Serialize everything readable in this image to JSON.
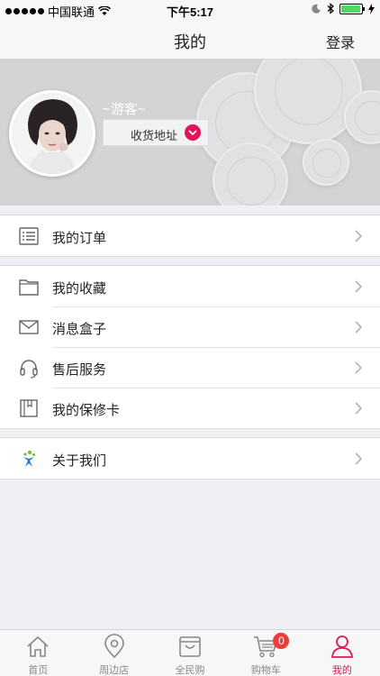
{
  "status": {
    "carrier": "中国联通",
    "time": "下午5:17",
    "battery_level": 0.95
  },
  "nav": {
    "title": "我的",
    "login_label": "登录"
  },
  "profile": {
    "guest_name": "~游客~",
    "address_label": "收货地址"
  },
  "menu": {
    "orders": {
      "label": "我的订单",
      "icon": "list-icon"
    },
    "favorites": {
      "label": "我的收藏",
      "icon": "folder-icon"
    },
    "messages": {
      "label": "消息盒子",
      "icon": "mail-icon"
    },
    "after_sales": {
      "label": "售后服务",
      "icon": "headset-icon"
    },
    "warranty": {
      "label": "我的保修卡",
      "icon": "book-icon"
    },
    "about": {
      "label": "关于我们",
      "icon": "logo-icon"
    }
  },
  "tabs": [
    {
      "label": "首页",
      "icon": "home-icon"
    },
    {
      "label": "周边店",
      "icon": "location-pin-icon"
    },
    {
      "label": "全民购",
      "icon": "shopping-bag-icon"
    },
    {
      "label": "购物车",
      "icon": "cart-icon",
      "badge": "0"
    },
    {
      "label": "我的",
      "icon": "person-icon",
      "active": true
    }
  ],
  "colors": {
    "accent": "#e4145c",
    "badge": "#f03a3a"
  }
}
